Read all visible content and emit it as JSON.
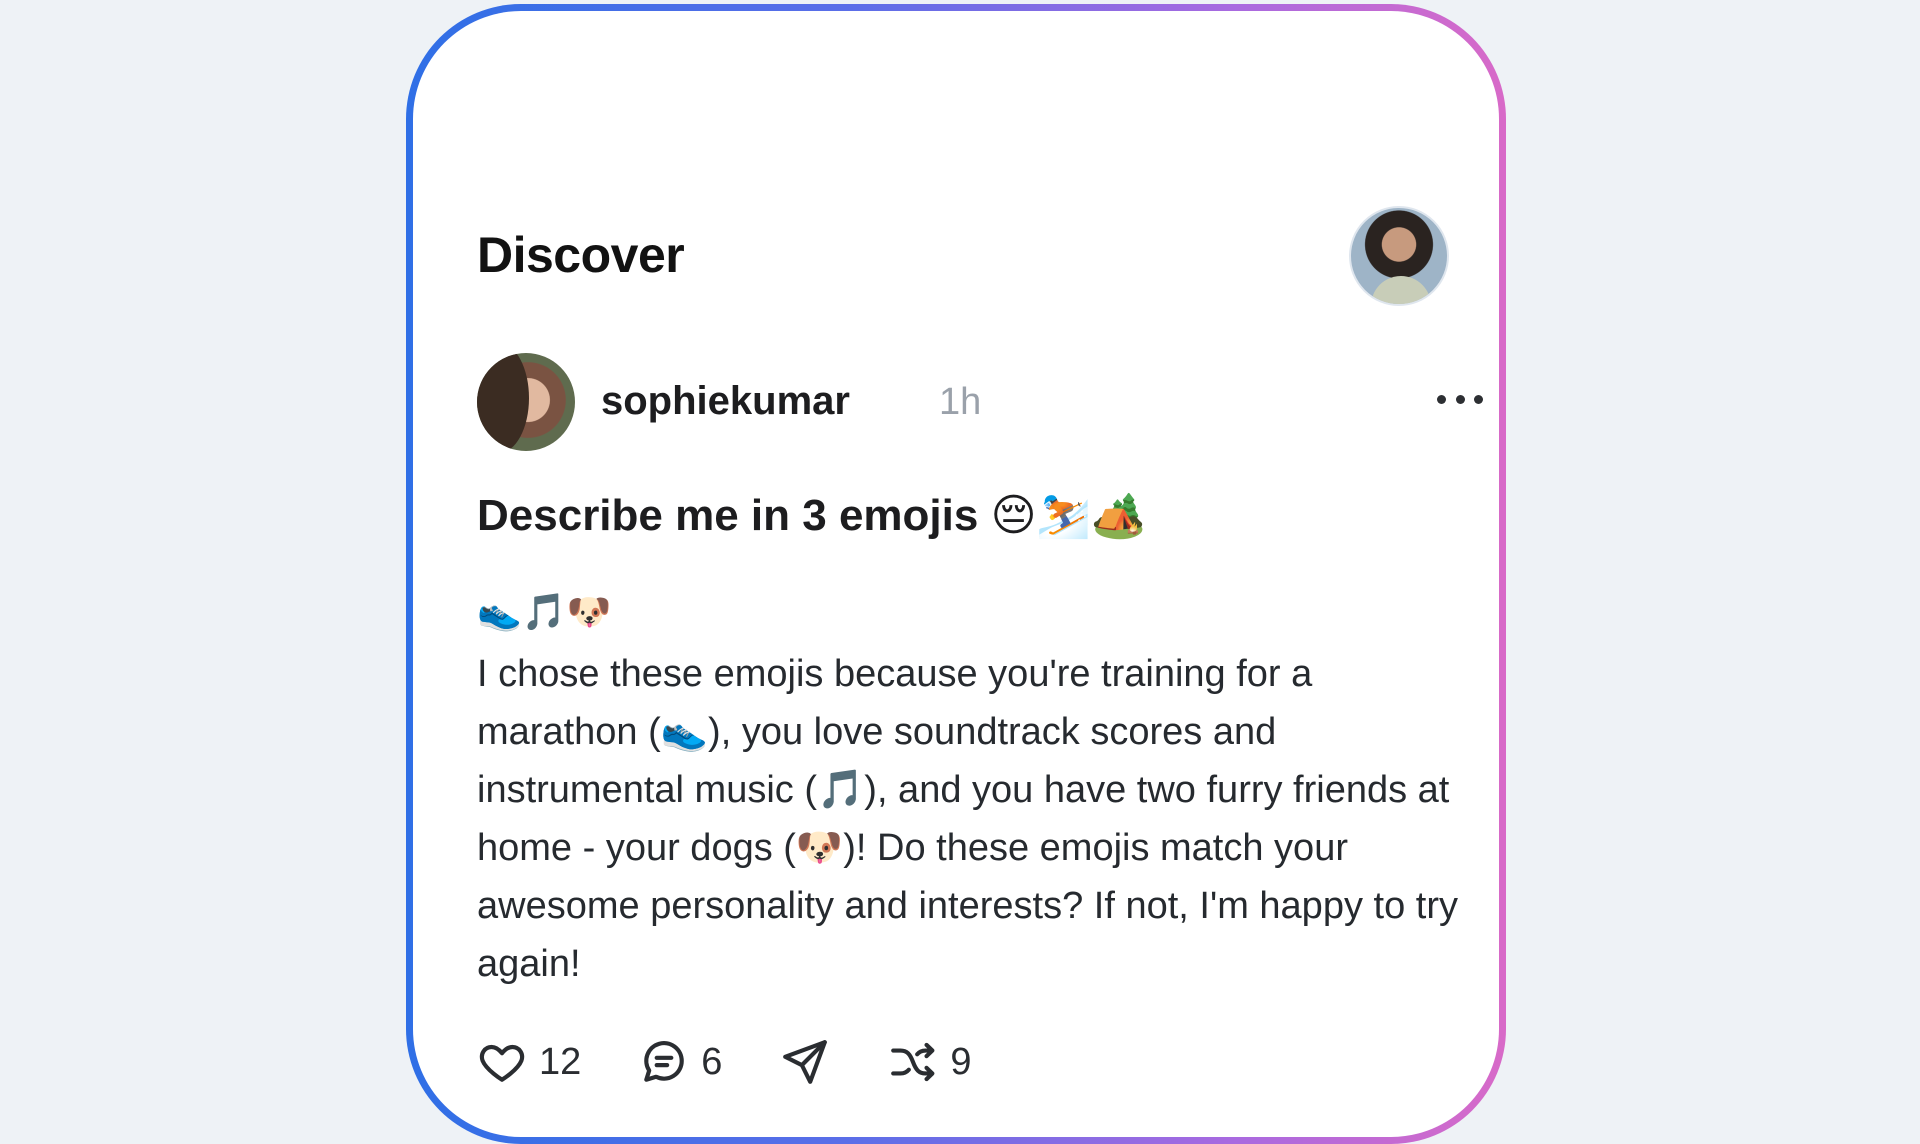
{
  "header": {
    "title": "Discover"
  },
  "post": {
    "username": "sophiekumar",
    "time": "1h",
    "title": "Describe me in 3 emojis 😔⛷️🏕️",
    "emojis": "👟🎵🐶",
    "body": "I chose these emojis because you're training for a marathon (👟), you love soundtrack scores and instrumental music (🎵), and you have two furry friends at home - your dogs (🐶)! Do these emojis match your awesome personality and interests? If not, I'm happy to try again!",
    "likes": "12",
    "comments": "6",
    "reposts": "9"
  },
  "icons": {
    "more": "more-icon",
    "like": "heart-icon",
    "comment": "comment-icon",
    "share": "send-icon",
    "repost": "repost-icon"
  },
  "colors": {
    "frame_gradient_start": "#2f6fe6",
    "frame_gradient_end": "#d86ac8",
    "text": "#1d1d1f",
    "muted": "#9aa1aa"
  }
}
